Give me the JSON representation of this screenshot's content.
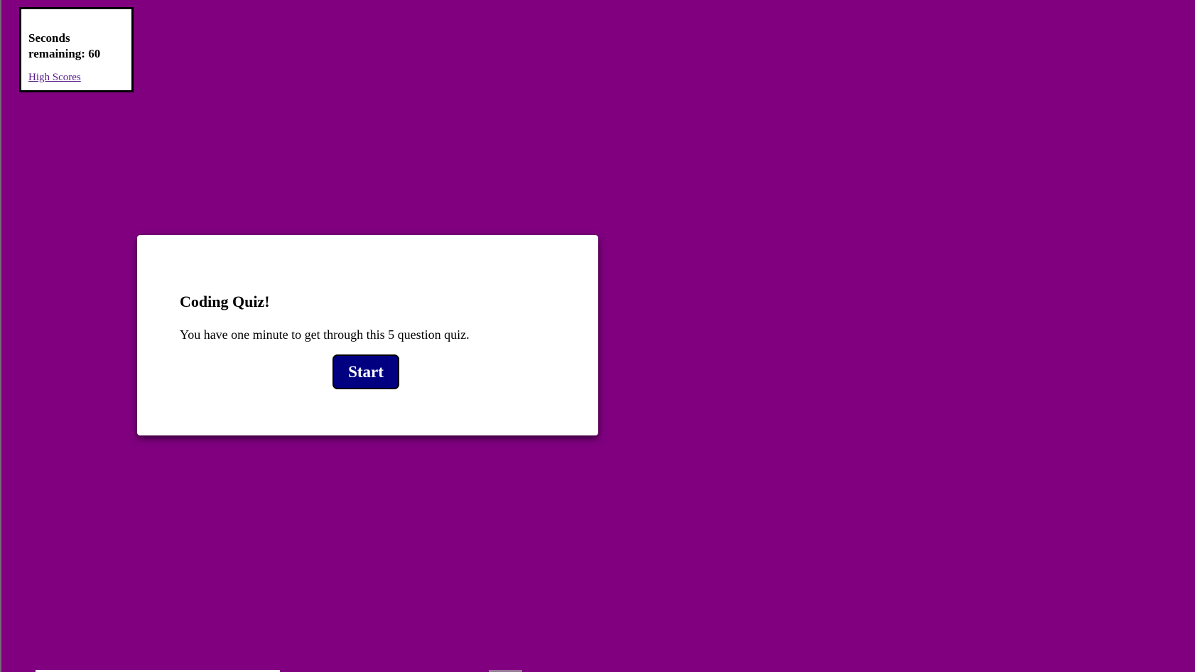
{
  "timer": {
    "label": "Seconds remaining: 60",
    "seconds": 60
  },
  "nav": {
    "high_scores_label": "High Scores"
  },
  "quiz": {
    "title": "Coding Quiz!",
    "description": "You have one minute to get through this 5 question quiz.",
    "start_label": "Start"
  },
  "colors": {
    "background": "#800080",
    "card": "#ffffff",
    "button": "#000080",
    "link": "#551a8b"
  }
}
